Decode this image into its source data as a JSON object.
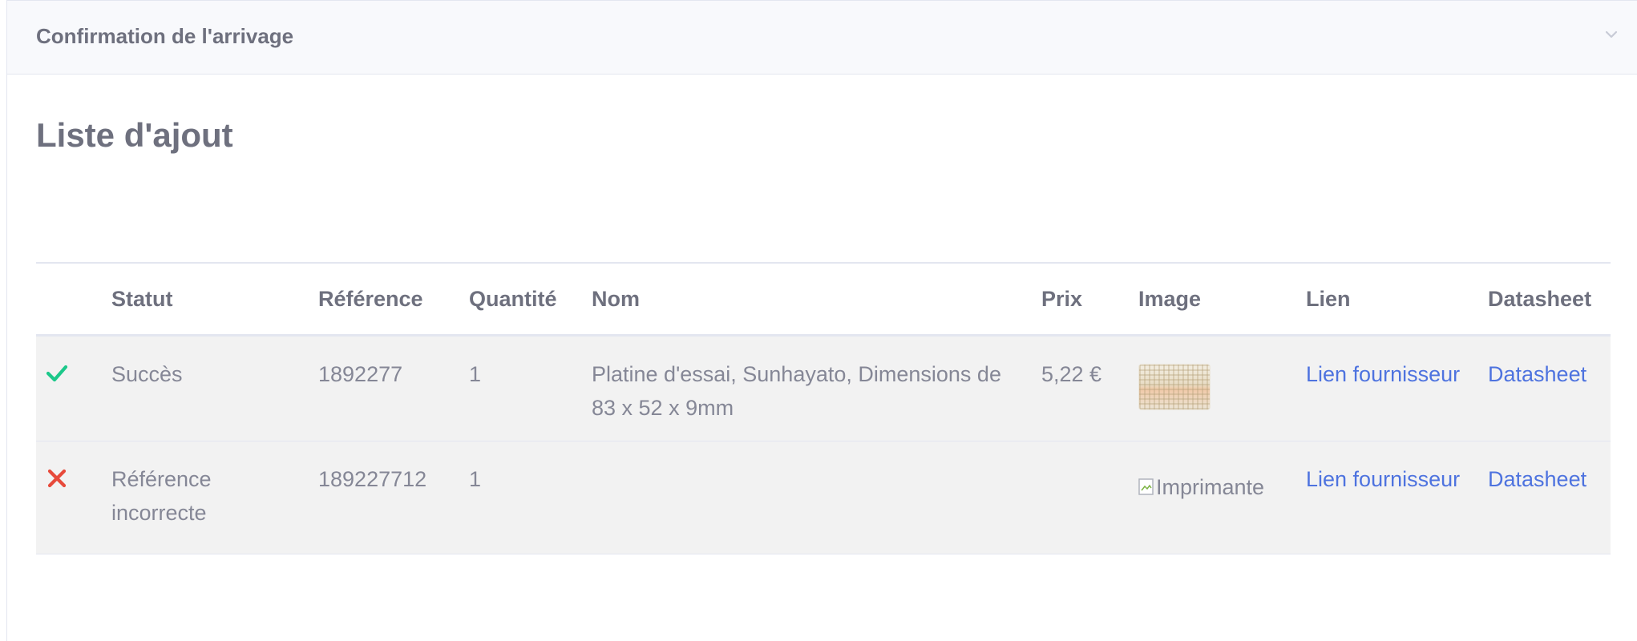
{
  "header": {
    "title": "Confirmation de l'arrivage"
  },
  "section": {
    "title": "Liste d'ajout"
  },
  "table": {
    "columns": [
      "",
      "Statut",
      "Référence",
      "Quantité",
      "Nom",
      "Prix",
      "Image",
      "Lien",
      "Datasheet"
    ],
    "rows": [
      {
        "status_icon": "check-icon",
        "status": "Succès",
        "reference": "1892277",
        "quantity": "1",
        "name": "Platine d'essai, Sunhayato, Dimensions de 83 x 52 x 9mm",
        "price": "5,22 €",
        "image_alt": "",
        "link": "Lien fournisseur",
        "datasheet": "Datasheet"
      },
      {
        "status_icon": "cross-icon",
        "status": "Référence incorrecte",
        "reference": "189227712",
        "quantity": "1",
        "name": "",
        "price": "",
        "image_alt": "Imprimante",
        "link": "Lien fournisseur",
        "datasheet": "Datasheet"
      }
    ]
  },
  "colors": {
    "success": "#1cc88a",
    "error": "#e74a3b",
    "link": "#4e73df",
    "header_bg": "#f8f9fc",
    "row_bg": "#f2f2f2"
  }
}
